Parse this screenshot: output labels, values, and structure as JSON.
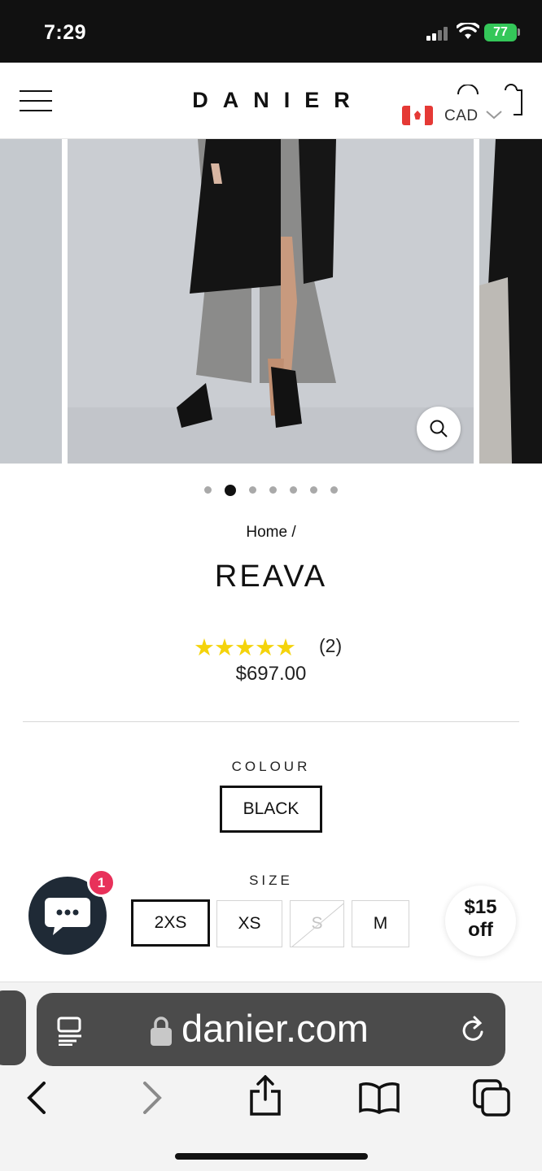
{
  "status_bar": {
    "time": "7:29",
    "battery": "77"
  },
  "header": {
    "logo": "DANIER",
    "currency": "CAD"
  },
  "gallery": {
    "slide_count": 7,
    "active_index": 1
  },
  "product": {
    "breadcrumb": "Home /",
    "title": "REAVA",
    "rating": 5,
    "review_count": "(2)",
    "price": "$697.00"
  },
  "options": {
    "colour_label": "COLOUR",
    "colours": [
      "BLACK"
    ],
    "selected_colour": "BLACK",
    "size_label": "SIZE",
    "sizes": [
      "2XS",
      "XS",
      "S",
      "M"
    ],
    "selected_size": "2XS",
    "unavailable_sizes": [
      "S"
    ]
  },
  "chat": {
    "badge_count": "1"
  },
  "discount": {
    "amount": "$15",
    "suffix": "off"
  },
  "browser": {
    "url": "danier.com"
  },
  "colors": {
    "star": "#f4d30b",
    "chat_bg": "#1f2a36",
    "badge": "#e8315a",
    "battery": "#34c759"
  }
}
